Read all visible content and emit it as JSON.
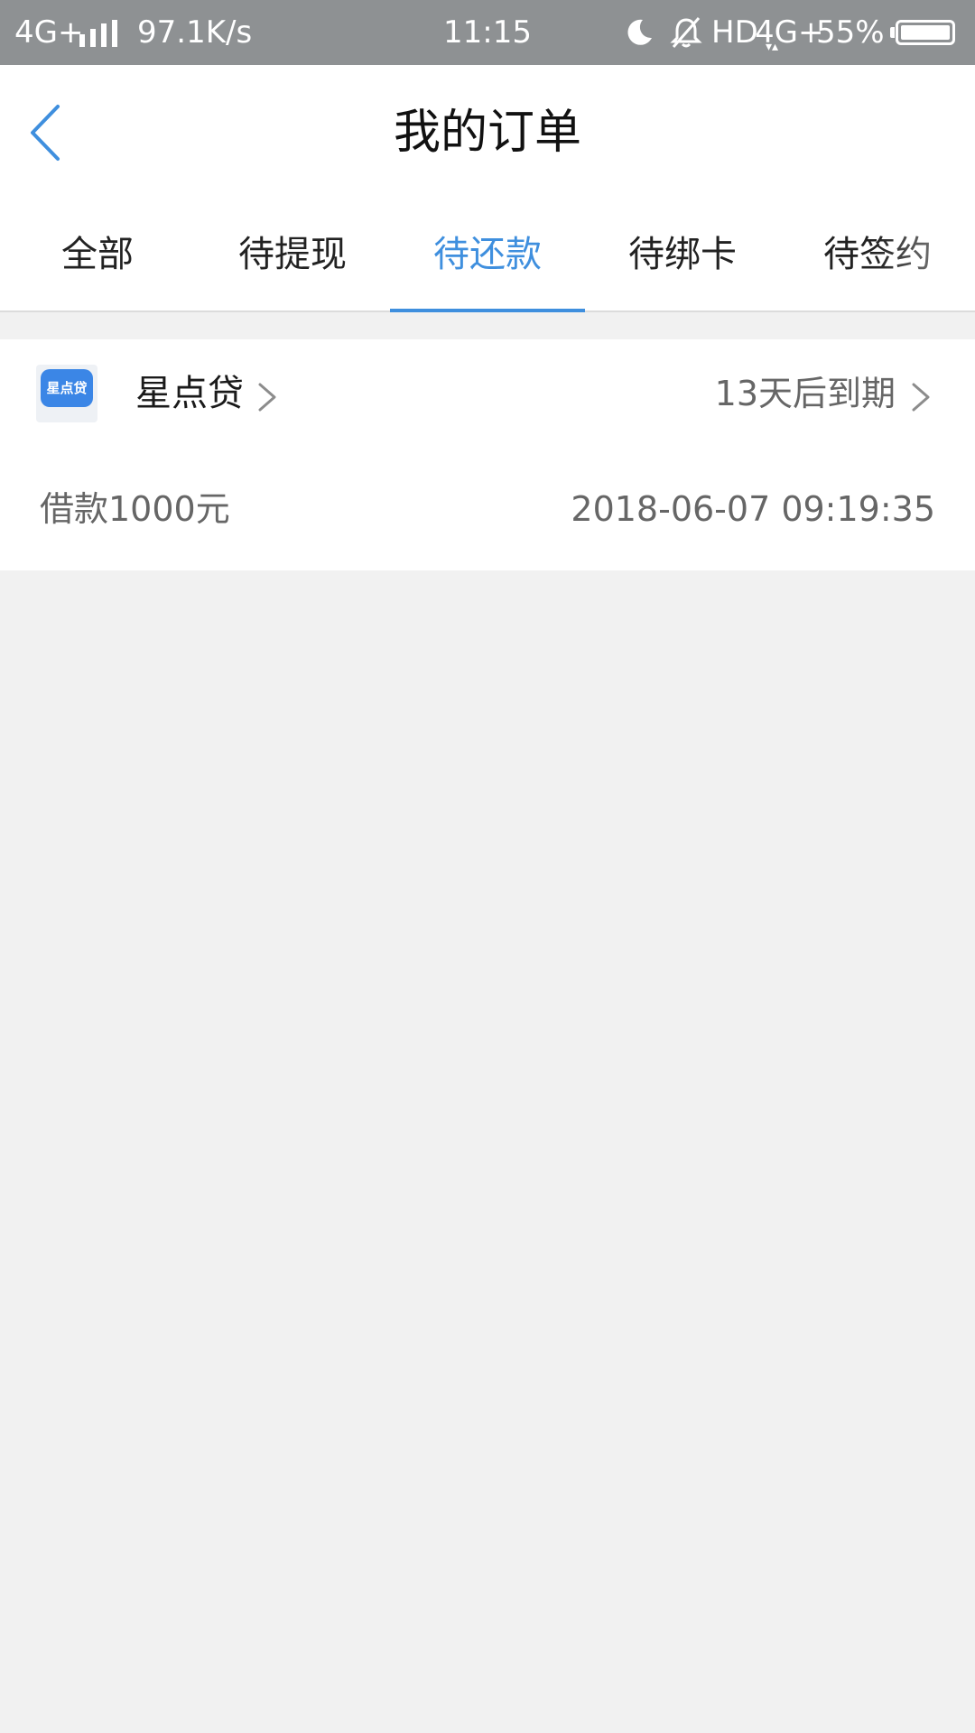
{
  "status_bar": {
    "network": "4G+",
    "speed": "97.1K/s",
    "time": "11:15",
    "hd": "HD",
    "network2": "4G+",
    "battery": "55%",
    "icons": [
      "signal-icon",
      "moon-icon",
      "bell-off-icon",
      "battery-icon"
    ]
  },
  "header": {
    "title": "我的订单",
    "back_icon": "chevron-left-icon"
  },
  "tabs": [
    {
      "label": "全部",
      "active": false
    },
    {
      "label": "待提现",
      "active": false
    },
    {
      "label": "待还款",
      "active": true
    },
    {
      "label": "待绑卡",
      "active": false
    },
    {
      "label": "待签约",
      "active": false
    }
  ],
  "order": {
    "logo_text": "星点贷",
    "lender_name": "星点贷",
    "due_text": "13天后到期",
    "amount_text": "借款1000元",
    "datetime": "2018-06-07 09:19:35"
  },
  "colors": {
    "accent": "#3f8fde",
    "status_bar": "#8e9193",
    "background": "#f1f1f1"
  }
}
